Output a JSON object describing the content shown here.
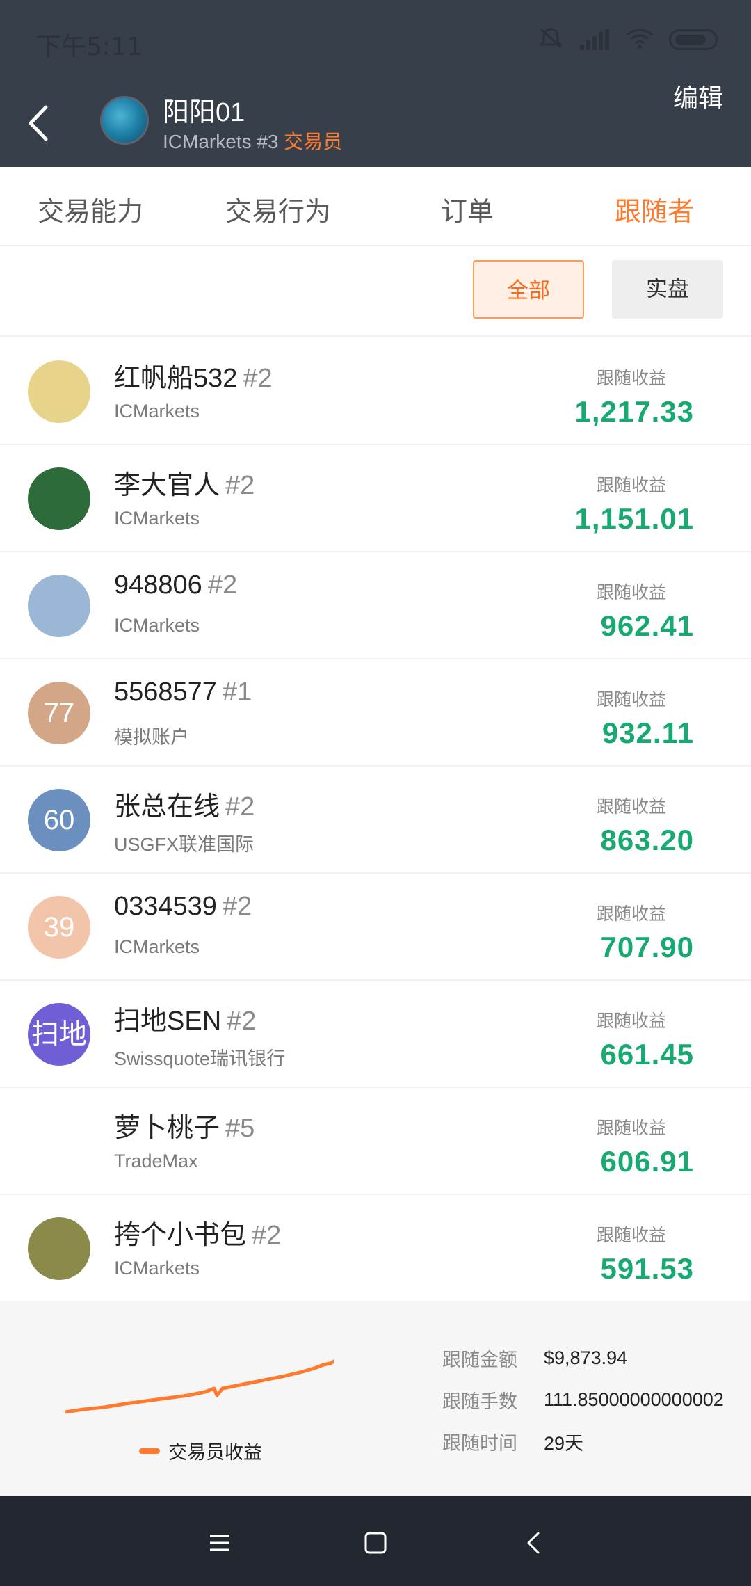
{
  "status": {
    "time": "下午5:11"
  },
  "header": {
    "name": "阳阳01",
    "broker_rank": "ICMarkets #3",
    "role": "交易员",
    "edit_label": "编辑"
  },
  "tabs": [
    {
      "label": "交易能力"
    },
    {
      "label": "交易行为"
    },
    {
      "label": "订单"
    },
    {
      "label": "跟随者",
      "active": true
    }
  ],
  "filters": {
    "all": "全部",
    "live": "实盘"
  },
  "followers": [
    {
      "name": "红帆船532",
      "rank": "#2",
      "broker": "ICMarkets",
      "label": "跟随收益",
      "value": "1,217.33",
      "avatar_text": "",
      "avatar_color": "#e8d38a"
    },
    {
      "name": "李大官人",
      "rank": "#2",
      "broker": "ICMarkets",
      "label": "跟随收益",
      "value": "1,151.01",
      "avatar_text": "",
      "avatar_color": "#2e6b3a"
    },
    {
      "name": "948806",
      "rank": "#2",
      "broker": "ICMarkets",
      "label": "跟随收益",
      "value": "962.41",
      "avatar_text": "",
      "avatar_color": "#9ab8d6"
    },
    {
      "name": "5568577",
      "rank": "#1",
      "broker": "模拟账户",
      "label": "跟随收益",
      "value": "932.11",
      "avatar_text": "77",
      "avatar_color": "#d3a688"
    },
    {
      "name": "张总在线",
      "rank": "#2",
      "broker": "USGFX联准国际",
      "label": "跟随收益",
      "value": "863.20",
      "avatar_text": "60",
      "avatar_color": "#6b8fbe"
    },
    {
      "name": "0334539",
      "rank": "#2",
      "broker": "ICMarkets",
      "label": "跟随收益",
      "value": "707.90",
      "avatar_text": "39",
      "avatar_color": "#f2c5aa"
    },
    {
      "name": "扫地SEN",
      "rank": "#2",
      "broker": "Swissquote瑞讯银行",
      "label": "跟随收益",
      "value": "661.45",
      "avatar_text": "扫地",
      "avatar_color": "#6e5fd6"
    },
    {
      "name": "萝卜桃子",
      "rank": "#5",
      "broker": "TradeMax",
      "label": "跟随收益",
      "value": "606.91",
      "avatar_text": "",
      "avatar_color": "#ffffff"
    },
    {
      "name": "挎个小书包",
      "rank": "#2",
      "broker": "ICMarkets",
      "label": "跟随收益",
      "value": "591.53",
      "avatar_text": "",
      "avatar_color": "#8a8a4a"
    }
  ],
  "summary": {
    "legend": "交易员收益",
    "stats": [
      {
        "label": "跟随金额",
        "value": "$9,873.94"
      },
      {
        "label": "跟随手数",
        "value": "111.85000000000002"
      },
      {
        "label": "跟随时间",
        "value": "29天"
      }
    ]
  },
  "colors": {
    "accent": "#ff7a2c",
    "profit": "#17a970",
    "header_bg": "#373f4b"
  }
}
